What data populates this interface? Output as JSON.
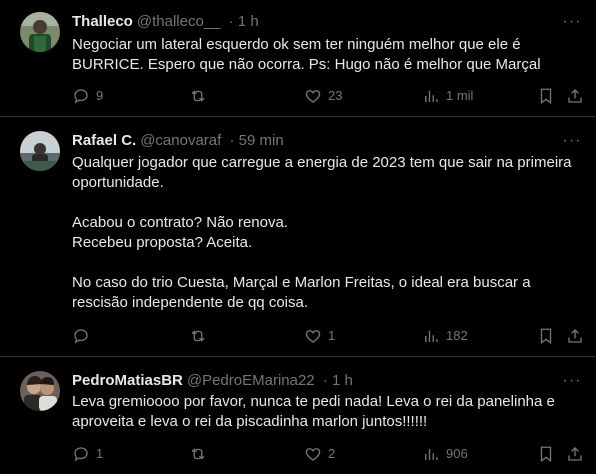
{
  "tweets": [
    {
      "name": "Thalleco",
      "handle": "@thalleco__",
      "time": "· 1 h",
      "lines": [
        "Negociar um lateral esquerdo ok sem ter ninguém melhor que ele é",
        "BURRICE. Espero que não ocorra. Ps: Hugo não é melhor que Marçal"
      ],
      "replies": "9",
      "retweets": "",
      "likes": "23",
      "views": "1 mil",
      "avatar_color": "#3a5a3a"
    },
    {
      "name": "Rafael C.",
      "handle": "@canovaraf",
      "time": "· 59 min",
      "lines": [
        "Qualquer jogador que carregue a energia de 2023 tem que sair na primeira",
        "oportunidade.",
        "",
        "Acabou o contrato? Não renova.",
        "Recebeu proposta? Aceita.",
        "",
        "No caso do trio Cuesta, Marçal e Marlon Freitas, o ideal era buscar a",
        "rescisão independente de qq coisa."
      ],
      "replies": "",
      "retweets": "",
      "likes": "1",
      "views": "182",
      "avatar_color": "#6f7f88"
    },
    {
      "name": "PedroMatiasBR",
      "handle": "@PedroEMarina22",
      "time": "· 1 h",
      "lines": [
        "Leva gremioooo por favor, nunca te pedi nada! Leva o rei da panelinha e",
        "aproveita e leva o rei da piscadinha marlon juntos!!!!!!"
      ],
      "replies": "1",
      "retweets": "",
      "likes": "2",
      "views": "906",
      "avatar_color": "#5a4a40"
    }
  ],
  "more_glyph": "···",
  "colors": {
    "background": "#000000",
    "text": "#e7e9ea",
    "muted": "#71767b",
    "border": "#2f3336"
  }
}
